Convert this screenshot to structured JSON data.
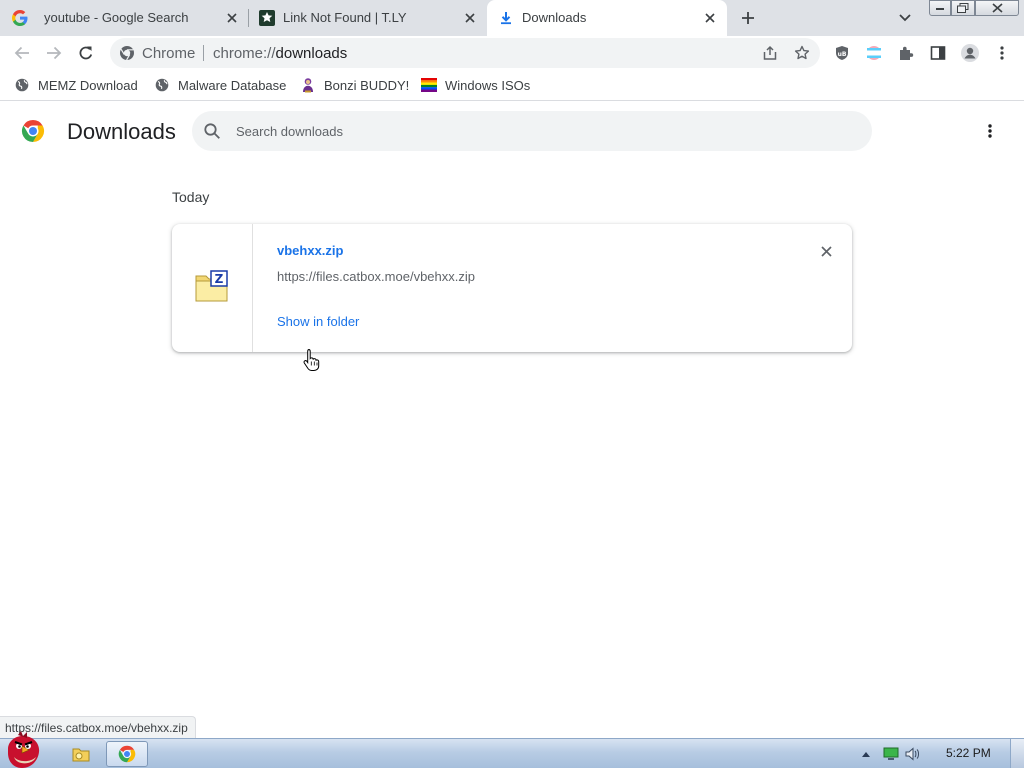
{
  "tabs": [
    {
      "title": "youtube - Google Search",
      "icon": "google-g-icon",
      "active": false
    },
    {
      "title": "Link Not Found | T.LY",
      "icon": "tly-logo-icon",
      "active": false
    },
    {
      "title": "Downloads",
      "icon": "download-arrow-icon",
      "active": true
    }
  ],
  "toolbar": {
    "site_label": "Chrome",
    "url_scheme": "chrome://",
    "url_host": "downloads"
  },
  "bookmarks": [
    {
      "label": "MEMZ Download",
      "icon": "globe-icon"
    },
    {
      "label": "Malware Database",
      "icon": "globe-icon"
    },
    {
      "label": "Bonzi BUDDY!",
      "icon": "bonzi-icon"
    },
    {
      "label": "Windows ISOs",
      "icon": "rainbow-flag-icon"
    }
  ],
  "downloads_page": {
    "title": "Downloads",
    "search_placeholder": "Search downloads",
    "date_heading": "Today",
    "items": [
      {
        "file_name": "vbehxx.zip",
        "source_url": "https://files.catbox.moe/vbehxx.zip",
        "action_label": "Show in folder",
        "icon": "zip-folder-icon"
      }
    ]
  },
  "status_bar": {
    "text": "https://files.catbox.moe/vbehxx.zip"
  },
  "taskbar": {
    "clock": "5:22 PM",
    "apps": [
      "explorer",
      "chrome"
    ]
  },
  "colors": {
    "accent": "#1a73e8",
    "tabstrip_bg": "#dee1e6",
    "omnibox_bg": "#f1f3f4"
  }
}
